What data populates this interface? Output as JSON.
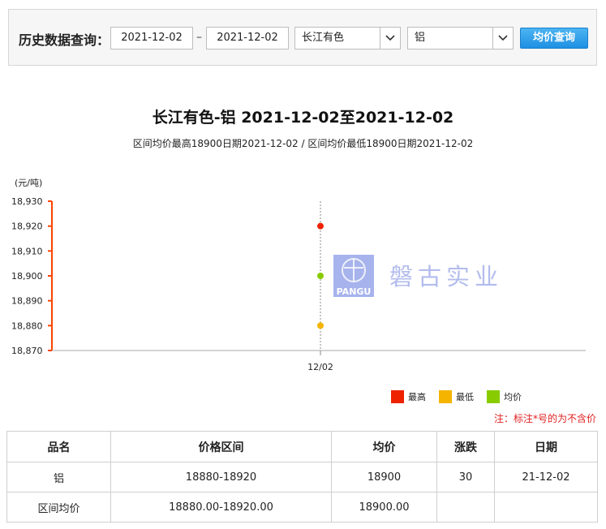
{
  "query": {
    "label": "历史数据查询：",
    "start_date": "2021-12-02",
    "separator": "–",
    "end_date": "2021-12-02",
    "market": "长江有色",
    "metal": "铝",
    "button_label": "均价查询"
  },
  "chart_data": {
    "type": "scatter",
    "title": "长江有色-铝 2021-12-02至2021-12-02",
    "subtitle": "区间均价最高18900日期2021-12-02 / 区间均价最低18900日期2021-12-02",
    "ylabel": "(元/吨)",
    "xlabel": "",
    "categories": [
      "12/02"
    ],
    "ylim": [
      18870,
      18930
    ],
    "yticks": [
      18870,
      18880,
      18890,
      18900,
      18910,
      18920,
      18930
    ],
    "ytick_labels": [
      "18,870",
      "18,880",
      "18,890",
      "18,900",
      "18,910",
      "18,920",
      "18,930"
    ],
    "series": [
      {
        "name": "最高",
        "color": "#ee2200",
        "values": [
          18920
        ]
      },
      {
        "name": "最低",
        "color": "#f5b400",
        "values": [
          18880
        ]
      },
      {
        "name": "均价",
        "color": "#88cc00",
        "values": [
          18900
        ]
      }
    ],
    "legend": "bottom-right",
    "grid": false,
    "axis_color": "#ff4500"
  },
  "watermark": {
    "logo_text": "PANGU",
    "company": "磐古实业"
  },
  "note": "注：标注*号的为不含价",
  "table": {
    "headers": [
      "品名",
      "价格区间",
      "均价",
      "涨跌",
      "日期"
    ],
    "rows": [
      [
        "铝",
        "18880-18920",
        "18900",
        "30",
        "21-12-02"
      ],
      [
        "区间均价",
        "18880.00-18920.00",
        "18900.00",
        "",
        ""
      ]
    ]
  }
}
